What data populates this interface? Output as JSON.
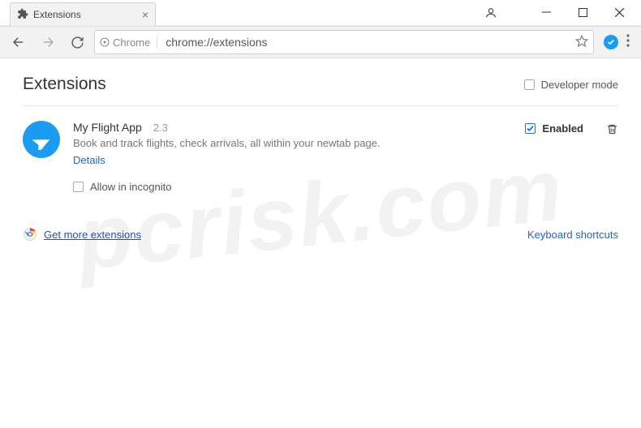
{
  "window": {
    "tab_title": "Extensions"
  },
  "omnibox": {
    "scheme_label": "Chrome",
    "url": "chrome://extensions"
  },
  "page": {
    "title": "Extensions",
    "developer_mode_label": "Developer mode"
  },
  "extension": {
    "name": "My Flight App",
    "version": "2.3",
    "description": "Book and track flights, check arrivals, all within your newtab page.",
    "details_label": "Details",
    "allow_incognito_label": "Allow in incognito",
    "enabled_label": "Enabled",
    "enabled_checked": true,
    "incognito_checked": false
  },
  "footer": {
    "get_more_label": "Get more extensions",
    "keyboard_shortcuts_label": "Keyboard shortcuts"
  },
  "watermark": "pcrisk.com"
}
